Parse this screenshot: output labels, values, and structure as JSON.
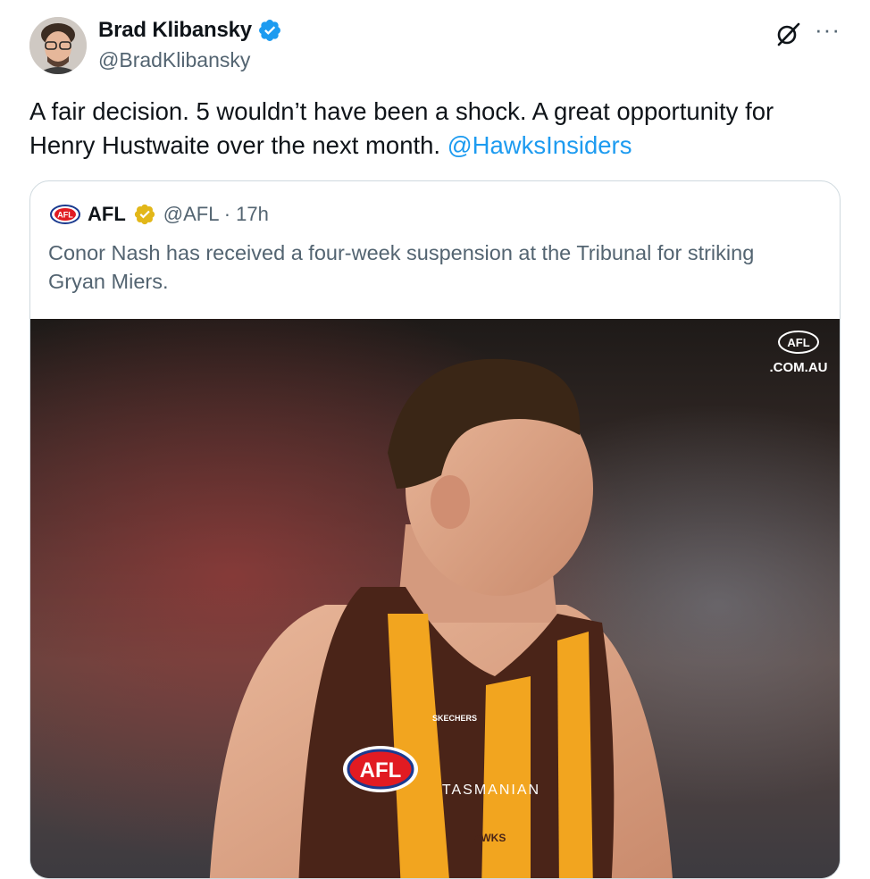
{
  "tweet": {
    "author_name": "Brad Klibansky",
    "author_handle": "@BradKlibansky",
    "text_main": "A fair decision. 5 wouldn’t have been a shock. A great opportunity for Henry Hustwaite over the next month.",
    "mention": "@HawksInsiders",
    "more_label": "···"
  },
  "quoted": {
    "name": "AFL",
    "handle_time": "@AFL · 17h",
    "text": "Conor Nash has received a four-week suspension at the Tribunal for striking Gryan Miers.",
    "logo_text": "AFL",
    "watermark_line1": "AFL",
    "watermark_line2": ".COM.AU",
    "jersey_text_sponsor": "TASMANIAN",
    "jersey_text_brand": "SKECHERS",
    "jersey_logo": "AFL",
    "jersey_club": "HAWKS"
  },
  "colors": {
    "accent": "#1d9bf0",
    "verified_blue": "#1d9bf0",
    "verified_gold": "#e2b719",
    "muted": "#536471",
    "border": "#cfd9de"
  },
  "icons": [
    "verified-badge-icon",
    "grok-icon",
    "more-icon",
    "afl-logo-icon",
    "gold-badge-icon"
  ]
}
